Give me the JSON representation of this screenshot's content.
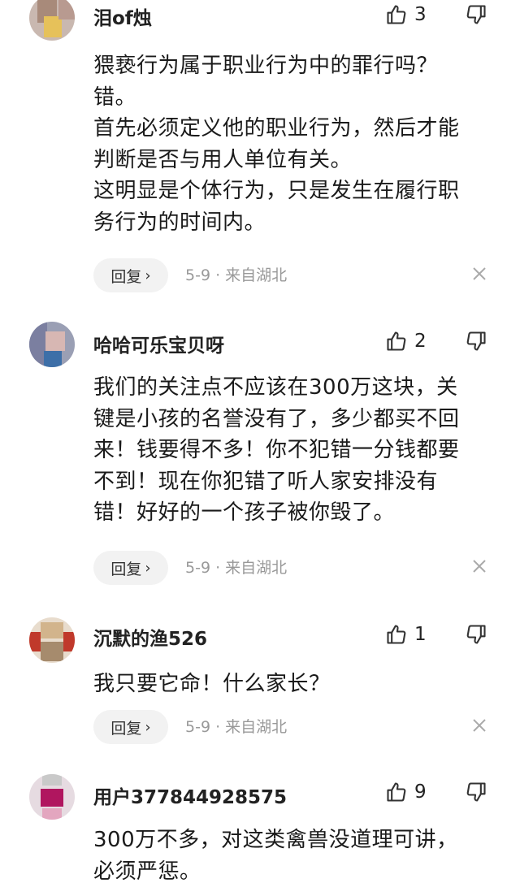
{
  "comments": [
    {
      "username": "泪of烛",
      "likes": "3",
      "lines": [
        "猥亵行为属于职业行为中的罪行吗？",
        "错。",
        "首先必须定义他的职业行为，然后才能",
        "判断是否与用人单位有关。",
        "这明显是个体行为，只是发生在履行职",
        "务行为的时间内。"
      ],
      "reply_label": "回复",
      "meta": "5-9 · 来自湖北"
    },
    {
      "username": "哈哈可乐宝贝呀",
      "likes": "2",
      "lines": [
        "我们的关注点不应该在300万这块，关",
        "键是小孩的名誉没有了，多少都买不回",
        "来！钱要得不多！你不犯错一分钱都要",
        "不到！现在你犯错了听人家安排没有",
        "错！好好的一个孩子被你毁了。"
      ],
      "reply_label": "回复",
      "meta": "5-9 · 来自湖北"
    },
    {
      "username": "沉默的渔526",
      "likes": "1",
      "lines": [
        "我只要它命！什么家长？"
      ],
      "reply_label": "回复",
      "meta": "5-9 · 来自湖北"
    },
    {
      "username": "用户377844928575",
      "likes": "9",
      "lines": [
        "300万不多，对这类禽兽没道理可讲，",
        "必须严惩。"
      ]
    }
  ],
  "icons": {
    "like": "thumbs-up-outline",
    "dislike": "thumbs-down-outline",
    "reply_chevron": "chevron-right",
    "close": "close-x"
  },
  "colors": {
    "text": "#1a1a1a",
    "meta": "#999999",
    "reply_bg": "#f2f2f2"
  }
}
